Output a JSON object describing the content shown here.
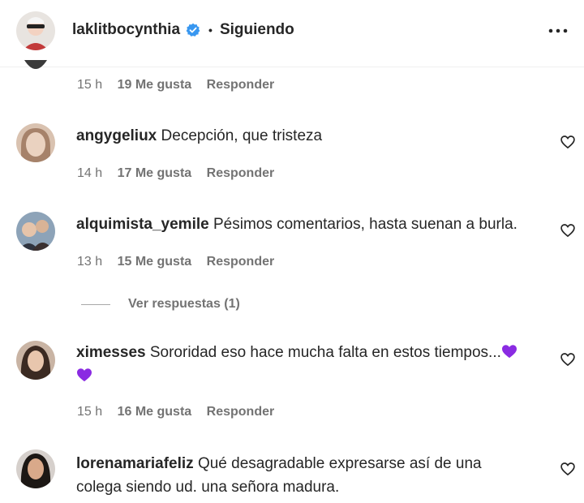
{
  "header": {
    "username": "laklitbocynthia",
    "separator": "•",
    "follow_status": "Siguiendo",
    "more_icon": "more-horizontal-icon"
  },
  "top_meta": {
    "time": "15 h",
    "likes": "19 Me gusta",
    "reply": "Responder"
  },
  "comments": [
    {
      "username": "angygeliux",
      "text": "Decepción, que tristeza",
      "time": "14 h",
      "likes": "17 Me gusta",
      "reply": "Responder"
    },
    {
      "username": "alquimista_yemile",
      "text": "Pésimos comentarios, hasta suenan a burla.",
      "time": "13 h",
      "likes": "15 Me gusta",
      "reply": "Responder"
    },
    {
      "username": "ximesses",
      "text": "Sororidad eso hace mucha falta en estos tiempos...",
      "time": "15 h",
      "likes": "16 Me gusta",
      "reply": "Responder"
    },
    {
      "username": "lorenamariafeliz",
      "text": "Qué desagradable expresarse así de una colega siendo ud. una señora madura."
    }
  ],
  "view_replies": "Ver respuestas (1)",
  "colors": {
    "verified": "#3897f0",
    "emoji_heart": "#8a2be2",
    "meta_text": "#737373"
  }
}
